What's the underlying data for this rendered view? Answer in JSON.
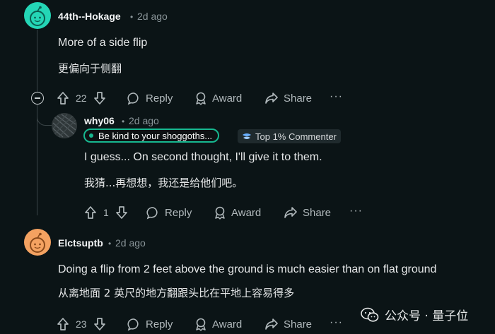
{
  "comments": [
    {
      "username": "44th--Hokage",
      "time": "2d ago",
      "text": "More of a side flip",
      "translation": "更偏向于侧翻",
      "score": "22",
      "avatar_color": "#24d6b6"
    },
    {
      "username": "why06",
      "time": "2d ago",
      "flair": "Be kind to your shoggoths...",
      "badge": "Top 1% Commenter",
      "text": "I guess... On second thought, I'll give it to them.",
      "translation": "我猜...再想想，我还是给他们吧。",
      "score": "1"
    },
    {
      "username": "Elctsuptb",
      "time": "2d ago",
      "text": "Doing a flip from 2 feet above the ground is much easier than on flat ground",
      "translation": "从离地面 2 英尺的地方翻跟头比在平地上容易得多",
      "score": "23",
      "avatar_color": "#f4a261"
    }
  ],
  "actions": {
    "reply": "Reply",
    "award": "Award",
    "share": "Share",
    "more": "···"
  },
  "meta": {
    "separator": "•"
  },
  "watermark": {
    "text": "公众号 · 量子位"
  },
  "colors": {
    "background": "#0b1416",
    "flair_border": "#17b890",
    "text": "#e5e7e8",
    "muted": "#8a9599"
  },
  "icons": [
    "upvote-icon",
    "downvote-icon",
    "comment-bubble-icon",
    "award-icon",
    "share-icon",
    "collapse-icon",
    "more-icon",
    "snoo-avatar-icon",
    "wechat-icon",
    "top-commenter-icon"
  ]
}
